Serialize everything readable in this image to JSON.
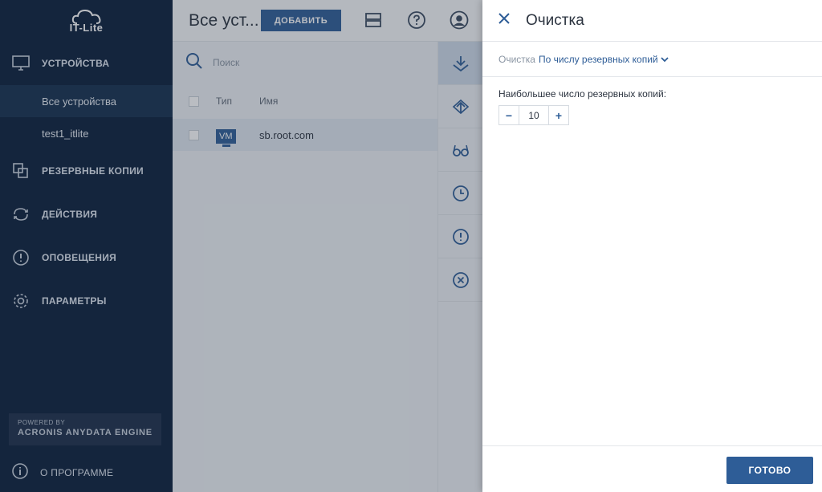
{
  "brand": {
    "logo_text": "IT-Lite"
  },
  "sidebar": {
    "nav": [
      {
        "label": "УСТРОЙСТВА",
        "icon": "monitor-icon"
      },
      {
        "label": "РЕЗЕРВНЫЕ КОПИИ",
        "icon": "copies-icon"
      },
      {
        "label": "ДЕЙСТВИЯ",
        "icon": "sync-icon"
      },
      {
        "label": "ОПОВЕЩЕНИЯ",
        "icon": "alert-icon"
      },
      {
        "label": "ПАРАМЕТРЫ",
        "icon": "gear-icon"
      }
    ],
    "sub_items": [
      "Все устройства",
      "test1_itlite"
    ],
    "powered_by": "POWERED BY",
    "engine": "ACRONIS ANYDATA ENGINE",
    "about": "О ПРОГРАММЕ"
  },
  "main": {
    "title": "Все уст...",
    "add_button": "ДОБАВИТЬ",
    "search_placeholder": "Поиск",
    "columns": [
      "Тип",
      "Имя"
    ],
    "rows": [
      {
        "type": "VM",
        "name": "sb.root.com"
      }
    ]
  },
  "panel": {
    "title": "Очистка",
    "crumb_label": "Очистка",
    "crumb_value": "По числу резервных копий",
    "field_label": "Наибольшее число резервных копий:",
    "stepper_value": "10",
    "minus": "−",
    "plus": "+",
    "done_button": "ГОТОВО"
  },
  "colors": {
    "sidebar": "#0b1f3b",
    "accent": "#2e5d97"
  }
}
